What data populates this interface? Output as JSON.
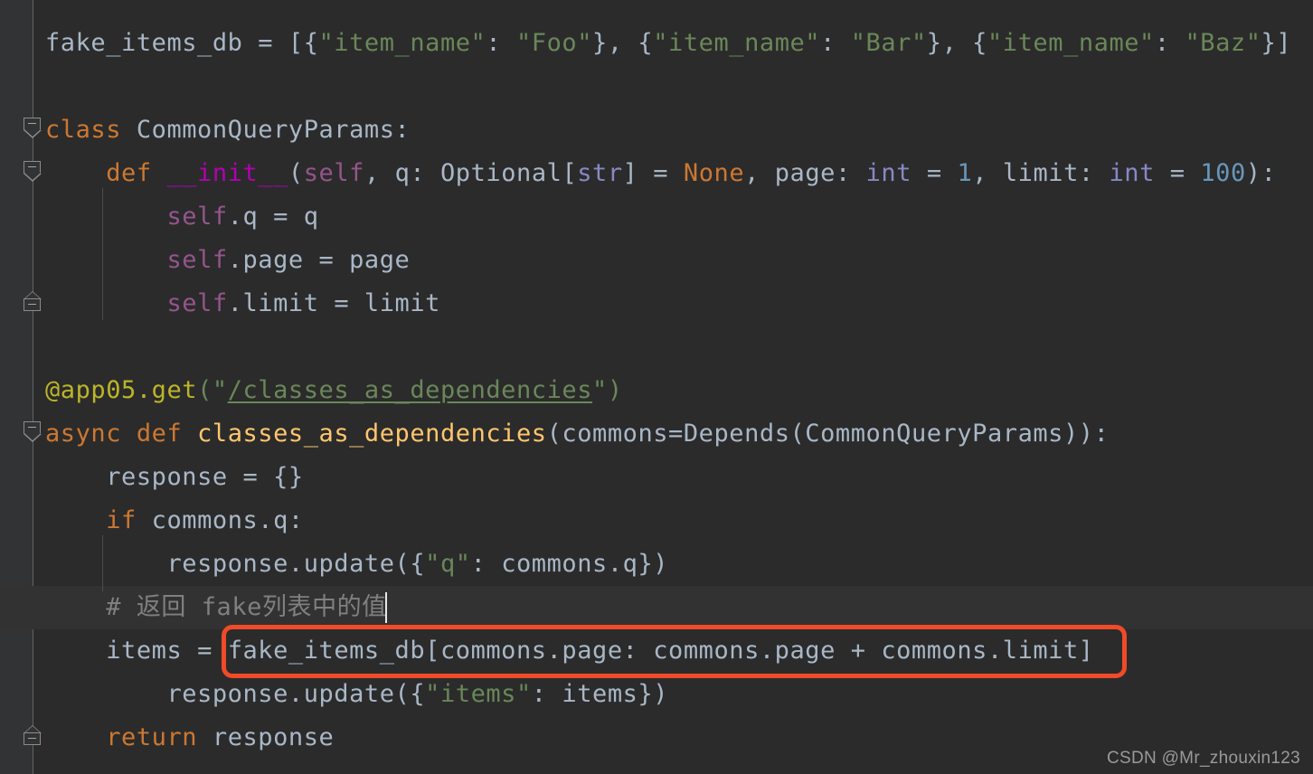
{
  "editor": {
    "app": "pycharm-code-editor",
    "language": "Python",
    "background_color": "#2b2b2b",
    "gutter_color": "#313335",
    "caret_line_color": "#323232",
    "theme": "Darcula"
  },
  "code_lines": [
    {
      "n": 1,
      "text": "fake_items_db = [{\"item_name\": \"Foo\"}, {\"item_name\": \"Bar\"}, {\"item_name\": \"Baz\"}]"
    },
    {
      "n": 2,
      "text": ""
    },
    {
      "n": 3,
      "text": "class CommonQueryParams:"
    },
    {
      "n": 4,
      "text": "    def __init__(self, q: Optional[str] = None, page: int = 1, limit: int = 100):"
    },
    {
      "n": 5,
      "text": "        self.q = q"
    },
    {
      "n": 6,
      "text": "        self.page = page"
    },
    {
      "n": 7,
      "text": "        self.limit = limit"
    },
    {
      "n": 8,
      "text": ""
    },
    {
      "n": 9,
      "text": ""
    },
    {
      "n": 10,
      "text": "@app05.get(\"/classes_as_dependencies\")"
    },
    {
      "n": 11,
      "text": "async def classes_as_dependencies(commons=Depends(CommonQueryParams)):"
    },
    {
      "n": 12,
      "text": "    response = {}"
    },
    {
      "n": 13,
      "text": "    if commons.q:"
    },
    {
      "n": 14,
      "text": "        response.update({\"q\": commons.q})"
    },
    {
      "n": 15,
      "text": "    # 返回 fake列表中的值"
    },
    {
      "n": 16,
      "text": "    items = fake_items_db[commons.page: commons.page + commons.limit]"
    },
    {
      "n": 17,
      "text": "    response.update({\"items\": items})"
    },
    {
      "n": 18,
      "text": "    return response"
    }
  ],
  "tokens": {
    "l1": {
      "a": "fake_items_db = [{",
      "s1": "\"item_name\"",
      "b": ": ",
      "s2": "\"Foo\"",
      "c": "}, {",
      "s3": "\"item_name\"",
      "d": ": ",
      "s4": "\"Bar\"",
      "e": "}, {",
      "s5": "\"item_name\"",
      "f": ": ",
      "s6": "\"Baz\"",
      "g": "}]"
    },
    "l3": {
      "kw": "class",
      "rest": " CommonQueryParams:"
    },
    "l4": {
      "indent": "    ",
      "kw": "def",
      "sp": " ",
      "dunder": "__init__",
      "p1": "(",
      "self": "self",
      "p2": ", q: Optional[",
      "str_t": "str",
      "p3": "] = ",
      "none": "None",
      "p4": ", page: ",
      "int1": "int",
      "p5": " = ",
      "num1": "1",
      "p6": ", limit: ",
      "int2": "int",
      "p7": " = ",
      "num2": "100",
      "p8": "):"
    },
    "l5": {
      "indent": "        ",
      "self": "self",
      "rest": ".q = q"
    },
    "l6": {
      "indent": "        ",
      "self": "self",
      "rest": ".page = page"
    },
    "l7": {
      "indent": "        ",
      "self": "self",
      "rest": ".limit = limit"
    },
    "l10": {
      "deco": "@app05.get",
      "p1": "(\"",
      "url": "/classes_as_dependencies",
      "p2": "\")"
    },
    "l11": {
      "kw1": "async",
      "sp1": " ",
      "kw2": "def",
      "sp2": " ",
      "fn": "classes_as_dependencies",
      "rest": "(commons=Depends(CommonQueryParams)):"
    },
    "l12": {
      "indent": "    ",
      "text": "response = {}"
    },
    "l13": {
      "indent": "    ",
      "kw": "if",
      "rest": " commons.q:"
    },
    "l14": {
      "indent": "        ",
      "a": "response.update({",
      "s": "\"q\"",
      "b": ": commons.q})"
    },
    "l15": {
      "indent": "    ",
      "comment": "# 返回 fake列表中的值"
    },
    "l16": {
      "indent": "    ",
      "a": "items = ",
      "boxed": "fake_items_db[commons.page: commons.page + commons.limit]"
    },
    "l17": {
      "indent": "        ",
      "a": "response.update({",
      "s": "\"items\"",
      "b": ": items})"
    },
    "l18": {
      "indent": "    ",
      "kw": "return",
      "rest": " response"
    }
  },
  "annotation": {
    "name": "red-highlight-box",
    "color": "#f04a28",
    "target_line": 16,
    "target_text": "fake_items_db[commons.page: commons.page + commons.limit]"
  },
  "caret": {
    "line": 15,
    "after_text": "# 返回 fake列表中的值"
  },
  "watermark": {
    "text": "CSDN @Mr_zhouxin123"
  }
}
